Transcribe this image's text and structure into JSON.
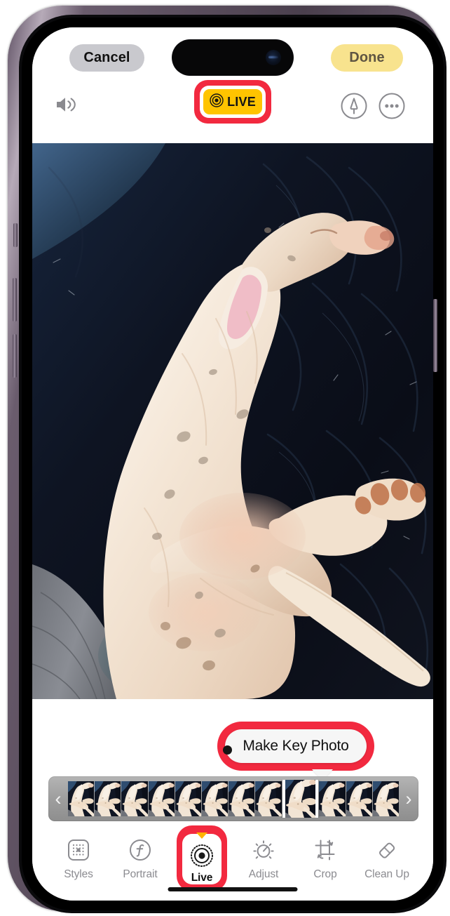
{
  "device": {
    "name": "iPhone",
    "frame_color": "#6a5c6d",
    "dynamic_island": "dynamic-island",
    "home_indicator": "home-indicator"
  },
  "app": {
    "name": "Photos",
    "screen": "Live Photo Editor"
  },
  "top_bar": {
    "cancel_label": "Cancel",
    "done_label": "Done",
    "speaker_icon": "speaker-wave-icon",
    "markup_icon": "markup-pen-icon",
    "more_icon": "more-options-icon",
    "live_badge": {
      "label": "LIVE",
      "icon": "live-photo-icon",
      "state": "on",
      "background": "#ffc400",
      "text_color": "#141414",
      "highlighted": true,
      "highlight_color": "#f2293f"
    }
  },
  "photo": {
    "alt": "White short-haired dog with faint brown spots curled up asleep on a dark navy blanket",
    "subject": "sleeping dog",
    "background": "dark navy blanket"
  },
  "key_photo_popup": {
    "label": "Make Key Photo",
    "highlighted": true,
    "highlight_color": "#f2293f",
    "background": "#f6f6f6",
    "text_color": "#111111"
  },
  "filmstrip": {
    "prev_arrow": "‹",
    "next_arrow": "›",
    "frame_count": 12,
    "selected_index": 8,
    "frames": [
      {
        "label": "frame-1"
      },
      {
        "label": "frame-2"
      },
      {
        "label": "frame-3"
      },
      {
        "label": "frame-4"
      },
      {
        "label": "frame-5"
      },
      {
        "label": "frame-6"
      },
      {
        "label": "frame-7"
      },
      {
        "label": "frame-8"
      },
      {
        "label": "frame-9"
      },
      {
        "label": "frame-10"
      },
      {
        "label": "frame-11"
      },
      {
        "label": "frame-12"
      }
    ]
  },
  "tool_bar": {
    "active": "Live",
    "highlight_color": "#f2293f",
    "marker_color": "#ffb300",
    "items": [
      {
        "label": "Styles",
        "icon": "styles-grid-icon",
        "active": false
      },
      {
        "label": "Portrait",
        "icon": "portrait-f-icon",
        "active": false
      },
      {
        "label": "Live",
        "icon": "live-photo-icon",
        "active": true
      },
      {
        "label": "Adjust",
        "icon": "adjust-dial-icon",
        "active": false
      },
      {
        "label": "Crop",
        "icon": "crop-rotate-icon",
        "active": false
      },
      {
        "label": "Clean Up",
        "icon": "clean-up-eraser-icon",
        "active": false
      }
    ]
  }
}
